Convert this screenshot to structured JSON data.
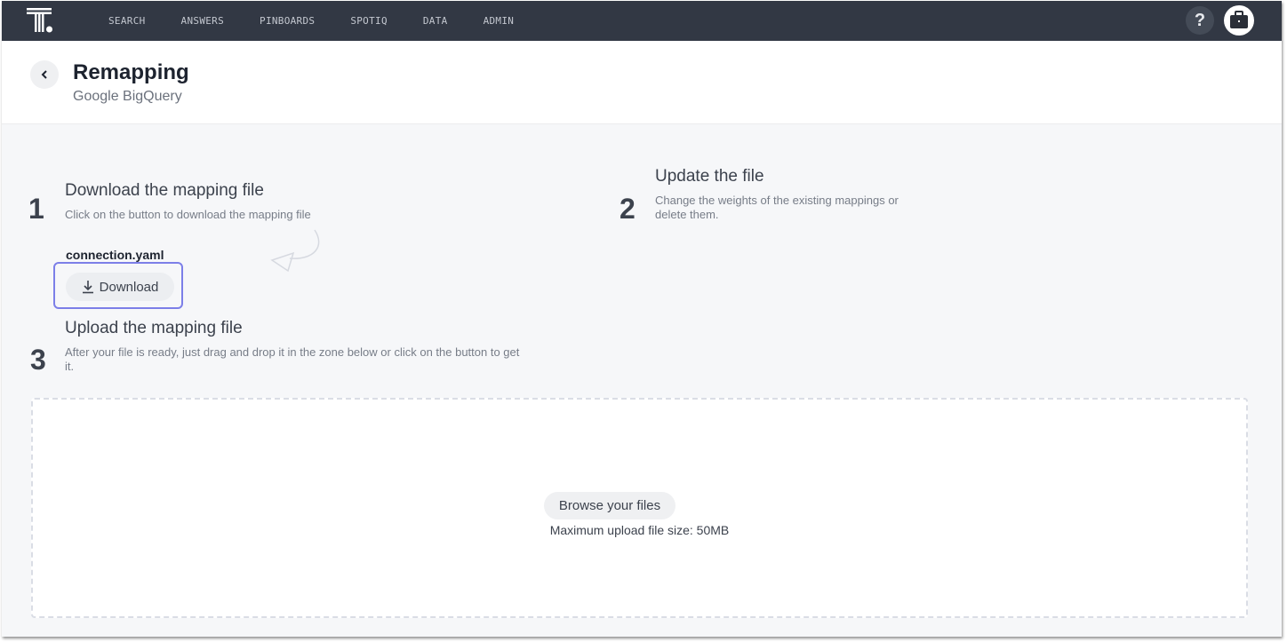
{
  "nav": {
    "logo": "thoughtspot-logo",
    "items": [
      {
        "label": "SEARCH"
      },
      {
        "label": "ANSWERS"
      },
      {
        "label": "PINBOARDS"
      },
      {
        "label": "SPOTIQ"
      },
      {
        "label": "DATA"
      },
      {
        "label": "ADMIN"
      }
    ],
    "help_label": "?",
    "help_icon": "help-icon",
    "profile_icon": "briefcase-icon"
  },
  "header": {
    "back_icon": "chevron-left-icon",
    "title": "Remapping",
    "subtitle": "Google BigQuery"
  },
  "steps": [
    {
      "number": "1",
      "title": "Download the mapping file",
      "description": "Click on the button to download the mapping file"
    },
    {
      "number": "2",
      "title": "Update the file",
      "description": "Change the weights of the existing mappings or delete them."
    },
    {
      "number": "3",
      "title": "Upload the mapping file",
      "description": "After your file is ready, just drag and drop it in the zone below or click on the button to get it."
    }
  ],
  "download": {
    "file_name": "connection.yaml",
    "button_label": "Download",
    "icon": "download-icon"
  },
  "upload": {
    "browse_label": "Browse your files",
    "max_size_text": "Maximum upload file size: 50MB"
  },
  "colors": {
    "nav_bg": "#323844",
    "focus_ring": "#7c7fe8",
    "page_bg": "#f6f7f9"
  }
}
